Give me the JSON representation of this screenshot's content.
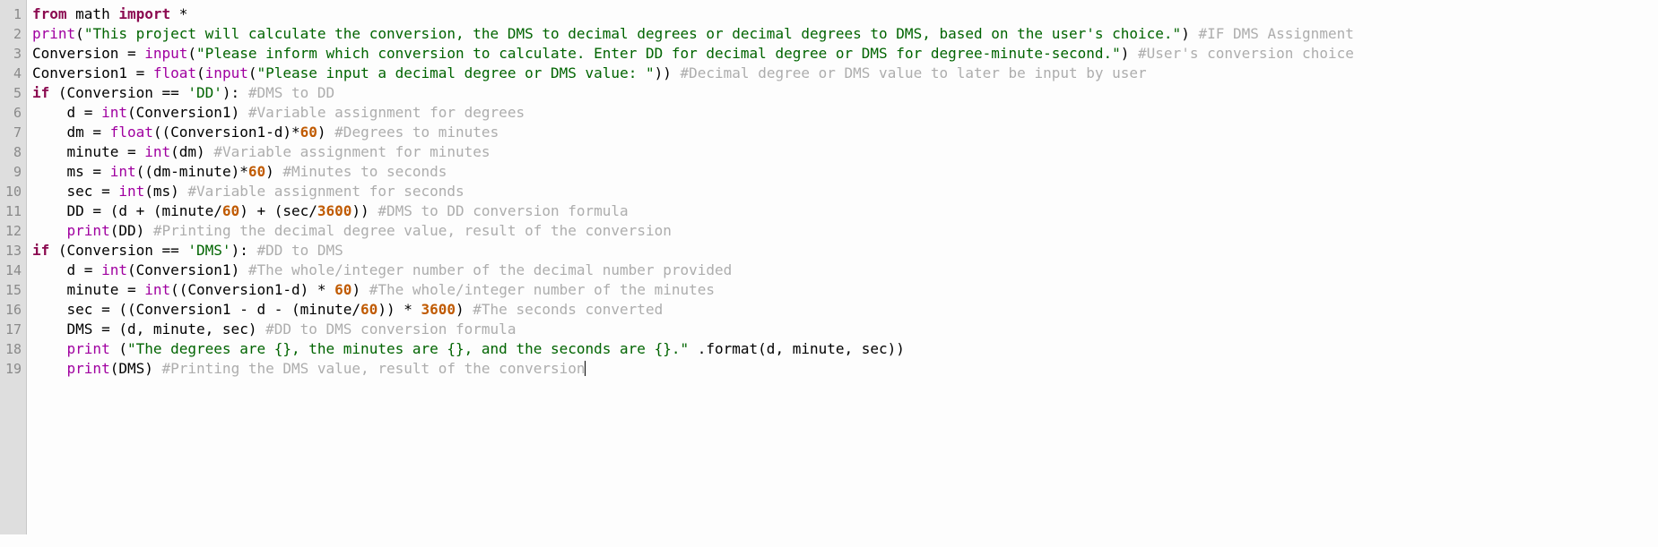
{
  "editor": {
    "language": "Python",
    "caret_line": 19,
    "total_lines": 19,
    "colors": {
      "background": "#fdfdfd",
      "gutter_background": "#dedede",
      "gutter_text": "#8a8a8a",
      "keyword": "#8b0a50",
      "builtin": "#a000a0",
      "string": "#006400",
      "comment": "#adadad",
      "number": "#c05a00",
      "plain_text": "#000000"
    }
  },
  "line_numbers": [
    "1",
    "2",
    "3",
    "4",
    "5",
    "6",
    "7",
    "8",
    "9",
    "10",
    "11",
    "12",
    "13",
    "14",
    "15",
    "16",
    "17",
    "18",
    "19"
  ],
  "code": {
    "lines": [
      {
        "number": "1",
        "tokens": [
          {
            "t": "kw",
            "s": "from"
          },
          {
            "t": "plain",
            "s": " math "
          },
          {
            "t": "kw",
            "s": "import"
          },
          {
            "t": "plain",
            "s": " *"
          }
        ]
      },
      {
        "number": "2",
        "tokens": [
          {
            "t": "builtin",
            "s": "print"
          },
          {
            "t": "plain",
            "s": "("
          },
          {
            "t": "str",
            "s": "\"This project will calculate the conversion, the DMS to decimal degrees or decimal degrees to DMS, based on the user's choice.\""
          },
          {
            "t": "plain",
            "s": ") "
          },
          {
            "t": "com",
            "s": "#IF DMS Assignment"
          }
        ]
      },
      {
        "number": "3",
        "tokens": [
          {
            "t": "plain",
            "s": "Conversion = "
          },
          {
            "t": "builtin",
            "s": "input"
          },
          {
            "t": "plain",
            "s": "("
          },
          {
            "t": "str",
            "s": "\"Please inform which conversion to calculate. Enter DD for decimal degree or DMS for degree-minute-second.\""
          },
          {
            "t": "plain",
            "s": ") "
          },
          {
            "t": "com",
            "s": "#User's conversion choice"
          }
        ]
      },
      {
        "number": "4",
        "tokens": [
          {
            "t": "plain",
            "s": "Conversion1 = "
          },
          {
            "t": "builtin",
            "s": "float"
          },
          {
            "t": "plain",
            "s": "("
          },
          {
            "t": "builtin",
            "s": "input"
          },
          {
            "t": "plain",
            "s": "("
          },
          {
            "t": "str",
            "s": "\"Please input a decimal degree or DMS value: \""
          },
          {
            "t": "plain",
            "s": ")) "
          },
          {
            "t": "com",
            "s": "#Decimal degree or DMS value to later be input by user"
          }
        ]
      },
      {
        "number": "5",
        "tokens": [
          {
            "t": "kw",
            "s": "if"
          },
          {
            "t": "plain",
            "s": " (Conversion == "
          },
          {
            "t": "str",
            "s": "'DD'"
          },
          {
            "t": "plain",
            "s": "): "
          },
          {
            "t": "com",
            "s": "#DMS to DD"
          }
        ]
      },
      {
        "number": "6",
        "tokens": [
          {
            "t": "plain",
            "s": "    d = "
          },
          {
            "t": "builtin",
            "s": "int"
          },
          {
            "t": "plain",
            "s": "(Conversion1) "
          },
          {
            "t": "com",
            "s": "#Variable assignment for degrees"
          }
        ]
      },
      {
        "number": "7",
        "tokens": [
          {
            "t": "plain",
            "s": "    dm = "
          },
          {
            "t": "builtin",
            "s": "float"
          },
          {
            "t": "plain",
            "s": "((Conversion1-d)*"
          },
          {
            "t": "num",
            "s": "60"
          },
          {
            "t": "plain",
            "s": ") "
          },
          {
            "t": "com",
            "s": "#Degrees to minutes"
          }
        ]
      },
      {
        "number": "8",
        "tokens": [
          {
            "t": "plain",
            "s": "    minute = "
          },
          {
            "t": "builtin",
            "s": "int"
          },
          {
            "t": "plain",
            "s": "(dm) "
          },
          {
            "t": "com",
            "s": "#Variable assignment for minutes"
          }
        ]
      },
      {
        "number": "9",
        "tokens": [
          {
            "t": "plain",
            "s": "    ms = "
          },
          {
            "t": "builtin",
            "s": "int"
          },
          {
            "t": "plain",
            "s": "((dm-minute)*"
          },
          {
            "t": "num",
            "s": "60"
          },
          {
            "t": "plain",
            "s": ") "
          },
          {
            "t": "com",
            "s": "#Minutes to seconds"
          }
        ]
      },
      {
        "number": "10",
        "tokens": [
          {
            "t": "plain",
            "s": "    sec = "
          },
          {
            "t": "builtin",
            "s": "int"
          },
          {
            "t": "plain",
            "s": "(ms) "
          },
          {
            "t": "com",
            "s": "#Variable assignment for seconds"
          }
        ]
      },
      {
        "number": "11",
        "tokens": [
          {
            "t": "plain",
            "s": "    DD = (d + (minute/"
          },
          {
            "t": "num",
            "s": "60"
          },
          {
            "t": "plain",
            "s": ") + (sec/"
          },
          {
            "t": "num",
            "s": "3600"
          },
          {
            "t": "plain",
            "s": ")) "
          },
          {
            "t": "com",
            "s": "#DMS to DD conversion formula"
          }
        ]
      },
      {
        "number": "12",
        "tokens": [
          {
            "t": "plain",
            "s": "    "
          },
          {
            "t": "builtin",
            "s": "print"
          },
          {
            "t": "plain",
            "s": "(DD) "
          },
          {
            "t": "com",
            "s": "#Printing the decimal degree value, result of the conversion"
          }
        ]
      },
      {
        "number": "13",
        "tokens": [
          {
            "t": "kw",
            "s": "if"
          },
          {
            "t": "plain",
            "s": " (Conversion == "
          },
          {
            "t": "str",
            "s": "'DMS'"
          },
          {
            "t": "plain",
            "s": "): "
          },
          {
            "t": "com",
            "s": "#DD to DMS"
          }
        ]
      },
      {
        "number": "14",
        "tokens": [
          {
            "t": "plain",
            "s": "    d = "
          },
          {
            "t": "builtin",
            "s": "int"
          },
          {
            "t": "plain",
            "s": "(Conversion1) "
          },
          {
            "t": "com",
            "s": "#The whole/integer number of the decimal number provided"
          }
        ]
      },
      {
        "number": "15",
        "tokens": [
          {
            "t": "plain",
            "s": "    minute = "
          },
          {
            "t": "builtin",
            "s": "int"
          },
          {
            "t": "plain",
            "s": "((Conversion1-d) * "
          },
          {
            "t": "num",
            "s": "60"
          },
          {
            "t": "plain",
            "s": ") "
          },
          {
            "t": "com",
            "s": "#The whole/integer number of the minutes"
          }
        ]
      },
      {
        "number": "16",
        "tokens": [
          {
            "t": "plain",
            "s": "    sec = ((Conversion1 - d - (minute/"
          },
          {
            "t": "num",
            "s": "60"
          },
          {
            "t": "plain",
            "s": ")) * "
          },
          {
            "t": "num",
            "s": "3600"
          },
          {
            "t": "plain",
            "s": ") "
          },
          {
            "t": "com",
            "s": "#The seconds converted"
          }
        ]
      },
      {
        "number": "17",
        "tokens": [
          {
            "t": "plain",
            "s": "    DMS = (d, minute, sec) "
          },
          {
            "t": "com",
            "s": "#DD to DMS conversion formula"
          }
        ]
      },
      {
        "number": "18",
        "tokens": [
          {
            "t": "plain",
            "s": "    "
          },
          {
            "t": "builtin",
            "s": "print"
          },
          {
            "t": "plain",
            "s": " ("
          },
          {
            "t": "str",
            "s": "\"The degrees are {}, the minutes are {}, and the seconds are {}.\""
          },
          {
            "t": "plain",
            "s": " .format(d, minute, sec))"
          }
        ]
      },
      {
        "number": "19",
        "tokens": [
          {
            "t": "plain",
            "s": "    "
          },
          {
            "t": "builtin",
            "s": "print"
          },
          {
            "t": "plain",
            "s": "(DMS) "
          },
          {
            "t": "com",
            "s": "#Printing the DMS value, result of the conversion"
          },
          {
            "t": "caret",
            "s": ""
          }
        ]
      }
    ]
  }
}
